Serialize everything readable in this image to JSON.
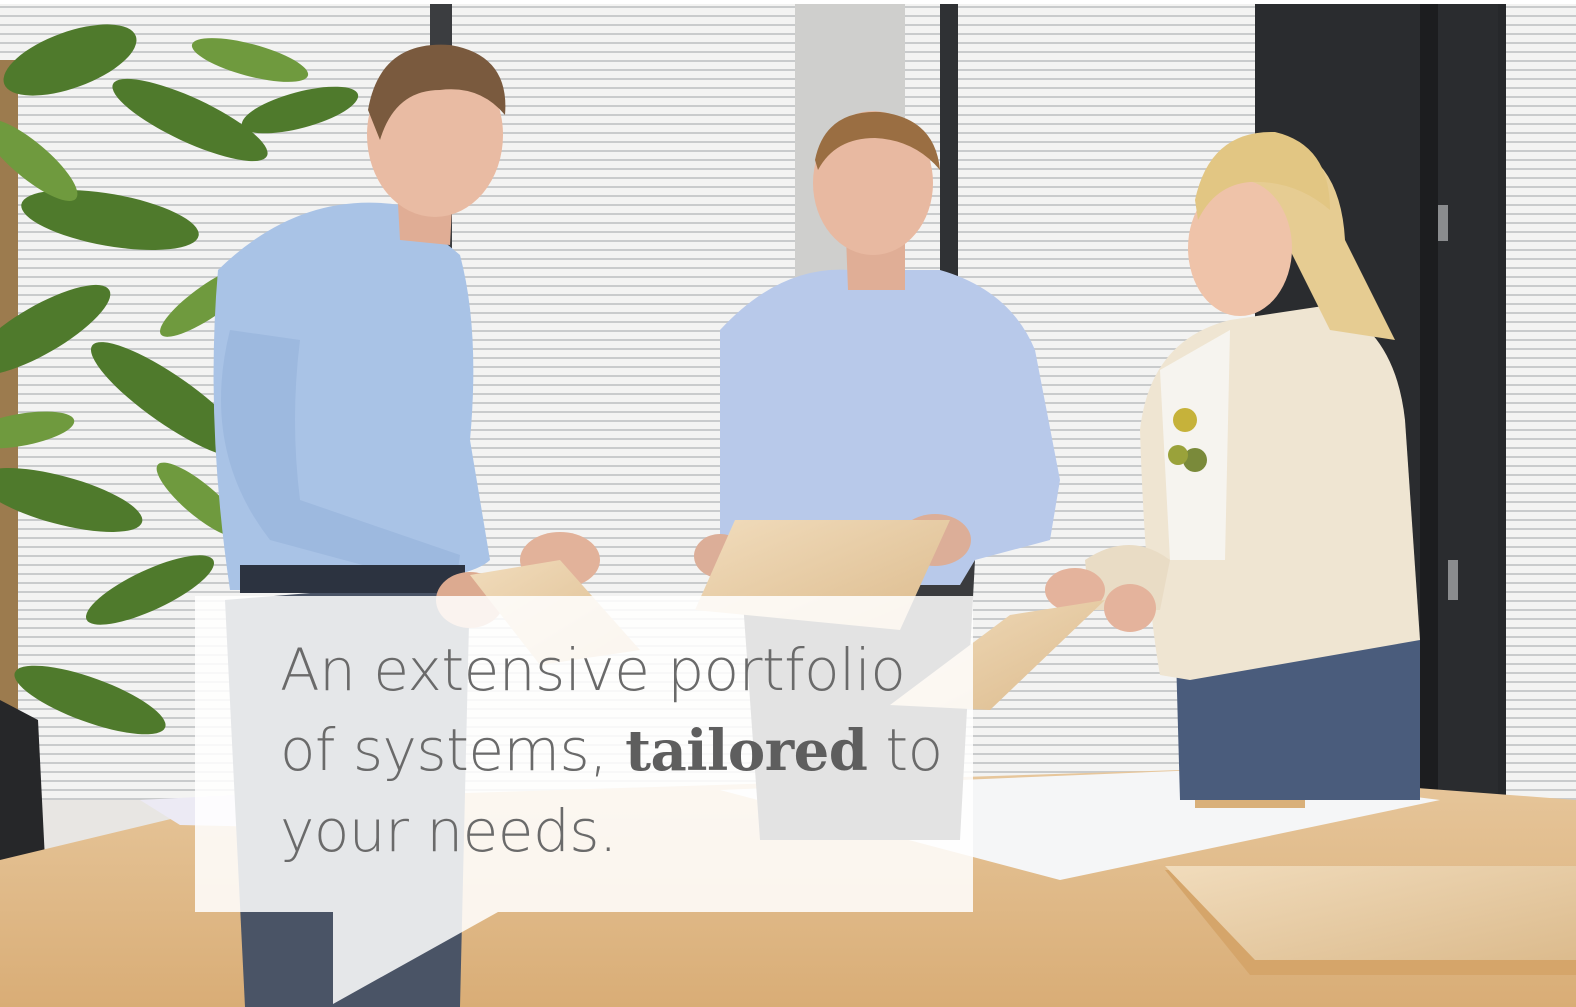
{
  "caption": {
    "part1": "An extensive portfolio",
    "part2": "of systems, ",
    "emphasis": "tailored",
    "part3": " to",
    "part4": "your needs."
  },
  "colors": {
    "shirt_blue": "#a9c3e6",
    "wood": "#e8c9a0",
    "jacket": "#efe5d2",
    "text_gray": "#6a6a6a"
  }
}
